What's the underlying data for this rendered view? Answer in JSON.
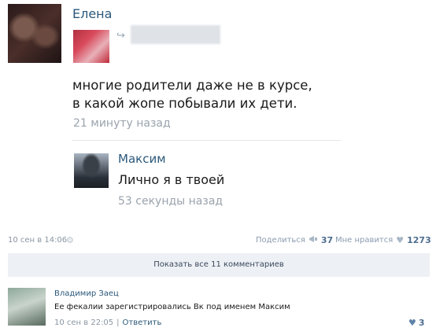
{
  "post": {
    "author": "Елена",
    "text_line1": "многие родители даже не в курсе,",
    "text_line2": "в какой жопе побывали их дети.",
    "time": "21 минуту назад",
    "reply": {
      "author": "Максим",
      "text": "Лично я в твоей",
      "time": "53 секунды назад"
    }
  },
  "footer": {
    "date": "10 сен в 14:06",
    "share_label": "Поделиться",
    "share_count": "37",
    "like_label": "Мне нравится",
    "like_count": "1273",
    "show_all": "Показать все 11 комментариев"
  },
  "comment": {
    "author": "Владимир Заец",
    "text": "Ее фекалии зарегистрировались Вк под именем Максим",
    "date": "10 сен в 22:05",
    "separator": "|",
    "reply_label": "Ответить",
    "like_count": "3"
  },
  "icons": {
    "repost": "↪",
    "gear": "⚙",
    "share": "📢",
    "heart": "♥"
  }
}
